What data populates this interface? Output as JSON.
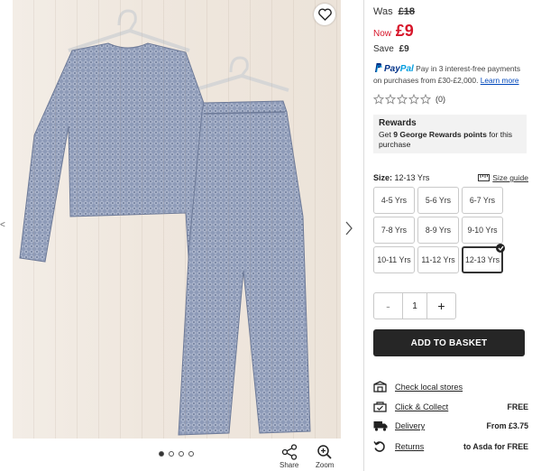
{
  "gallery": {
    "left_hint": "<",
    "dots": 4,
    "active_dot": 0,
    "share_label": "Share",
    "zoom_label": "Zoom"
  },
  "price": {
    "was_label": "Was",
    "was_value": "£18",
    "now_label": "Now",
    "now_value": "£9",
    "save_label": "Save",
    "save_value": "£9",
    "sale_color": "#d7162a"
  },
  "paypal": {
    "brand_pay": "Pay",
    "brand_pal": "Pal",
    "text": "Pay in 3 interest-free payments on purchases from £30-£2,000.",
    "link": "Learn more"
  },
  "rating": {
    "stars": 0,
    "max": 5,
    "count": "(0)"
  },
  "rewards": {
    "title": "Rewards",
    "pre": "Get ",
    "points": "9 George Rewards points",
    "post": " for this purchase"
  },
  "size": {
    "label": "Size:",
    "selected": "12-13 Yrs",
    "guide": "Size guide",
    "options": [
      "4-5 Yrs",
      "5-6 Yrs",
      "6-7 Yrs",
      "7-8 Yrs",
      "8-9 Yrs",
      "9-10 Yrs",
      "10-11 Yrs",
      "11-12 Yrs",
      "12-13 Yrs"
    ]
  },
  "quantity": {
    "minus": "-",
    "value": "1",
    "plus": "+"
  },
  "basket": {
    "label": "ADD TO BASKET"
  },
  "services": [
    {
      "icon": "store-icon",
      "label": "Check local stores",
      "value": ""
    },
    {
      "icon": "click-collect-icon",
      "label": "Click & Collect",
      "value": "FREE"
    },
    {
      "icon": "delivery-truck-icon",
      "label": "Delivery",
      "value": "From £3.75"
    },
    {
      "icon": "returns-icon",
      "label": "Returns",
      "value": "to Asda for FREE"
    }
  ]
}
